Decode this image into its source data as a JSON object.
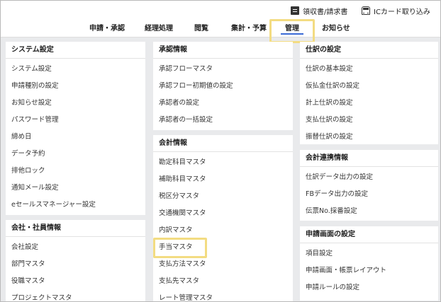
{
  "header": {
    "utility": {
      "receipt_label": "領収書/請求書",
      "receipt_icon": "document-icon",
      "ic_label": "ICカード取り込み",
      "ic_icon": "train-icon"
    },
    "nav": [
      {
        "label": "申請・承認"
      },
      {
        "label": "経理処理"
      },
      {
        "label": "閲覧"
      },
      {
        "label": "集計・予算"
      },
      {
        "label": "管理",
        "active": true
      },
      {
        "label": "お知らせ"
      }
    ],
    "accent_color": "#3b6bd6",
    "highlight_color": "#f3dc82"
  },
  "columns": {
    "left": [
      {
        "title": "システム設定",
        "items": [
          "システム設定",
          "申請種別の設定",
          "お知らせ設定",
          "パスワード管理",
          "締め日",
          "データ予約",
          "排他ロック",
          "通知メール設定",
          "eセールスマネージャー設定"
        ]
      },
      {
        "title": "会社・社員情報",
        "items": [
          "会社設定",
          "部門マスタ",
          "役職マスタ",
          "プロジェクトマスタ"
        ]
      }
    ],
    "middle": [
      {
        "title": "承認情報",
        "items": [
          "承認フローマスタ",
          "承認フロー初期値の設定",
          "承認者の設定",
          "承認者の一括設定"
        ]
      },
      {
        "title": "会計情報",
        "items": [
          "勘定科目マスタ",
          "補助科目マスタ",
          "税区分マスタ",
          "交通機関マスタ",
          "内訳マスタ",
          "手当マスタ",
          "支払方法マスタ",
          "支払先マスタ",
          "レート管理マスタ"
        ]
      }
    ],
    "right": [
      {
        "title": "仕訳の設定",
        "items": [
          "仕訳の基本設定",
          "仮払金仕訳の設定",
          "計上仕訳の設定",
          "支払仕訳の設定",
          "振替仕訳の設定"
        ]
      },
      {
        "title": "会計連携情報",
        "items": [
          "仕訳データ出力の設定",
          "FBデータ出力の設定",
          "伝票No.採番設定"
        ]
      },
      {
        "title": "申請画面の設定",
        "items": [
          "項目設定",
          "申請画面・帳票レイアウト",
          "申請ルールの設定"
        ]
      }
    ]
  }
}
